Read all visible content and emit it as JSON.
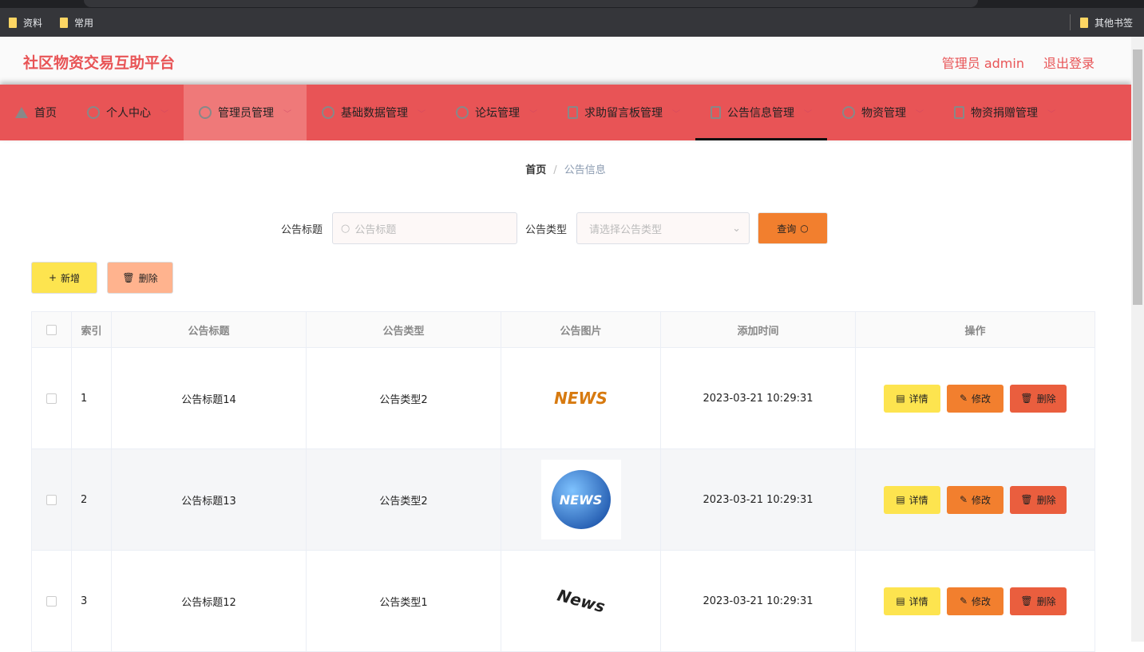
{
  "bookmarks": {
    "items": [
      "资料",
      "常用"
    ],
    "other": "其他书签"
  },
  "header": {
    "title": "社区物资交易互助平台",
    "user": "管理员 admin",
    "logout": "退出登录"
  },
  "nav": [
    {
      "label": "首页",
      "icon": "home-icon"
    },
    {
      "label": "个人中心",
      "icon": "user-icon"
    },
    {
      "label": "管理员管理",
      "icon": "crosshair-icon"
    },
    {
      "label": "基础数据管理",
      "icon": "power-icon"
    },
    {
      "label": "论坛管理",
      "icon": "clock-icon"
    },
    {
      "label": "求助留言板管理",
      "icon": "microphone-icon"
    },
    {
      "label": "公告信息管理",
      "icon": "clipboard-icon"
    },
    {
      "label": "物资管理",
      "icon": "gauge-icon"
    },
    {
      "label": "物资捐赠管理",
      "icon": "clipboard-x-icon"
    }
  ],
  "breadcrumb": {
    "home": "首页",
    "current": "公告信息"
  },
  "search": {
    "title_label": "公告标题",
    "title_placeholder": "公告标题",
    "type_label": "公告类型",
    "type_placeholder": "请选择公告类型",
    "query": "查询"
  },
  "actions": {
    "add": "新增",
    "delete": "删除"
  },
  "table": {
    "headers": [
      "索引",
      "公告标题",
      "公告类型",
      "公告图片",
      "添加时间",
      "操作"
    ],
    "rows": [
      {
        "index": "1",
        "title": "公告标题14",
        "type": "公告类型2",
        "image": "NEWS",
        "time": "2023-03-21 10:29:31"
      },
      {
        "index": "2",
        "title": "公告标题13",
        "type": "公告类型2",
        "image": "NEWS",
        "time": "2023-03-21 10:29:31"
      },
      {
        "index": "3",
        "title": "公告标题12",
        "type": "公告类型1",
        "image": "News",
        "time": "2023-03-21 10:29:31"
      }
    ],
    "ops": {
      "detail": "详情",
      "edit": "修改",
      "delete": "删除"
    }
  },
  "colors": {
    "primary": "#e85456",
    "yellow": "#fde44f",
    "orange": "#f27f2e",
    "red": "#ea5e3e",
    "salmon": "#ffb38e"
  }
}
